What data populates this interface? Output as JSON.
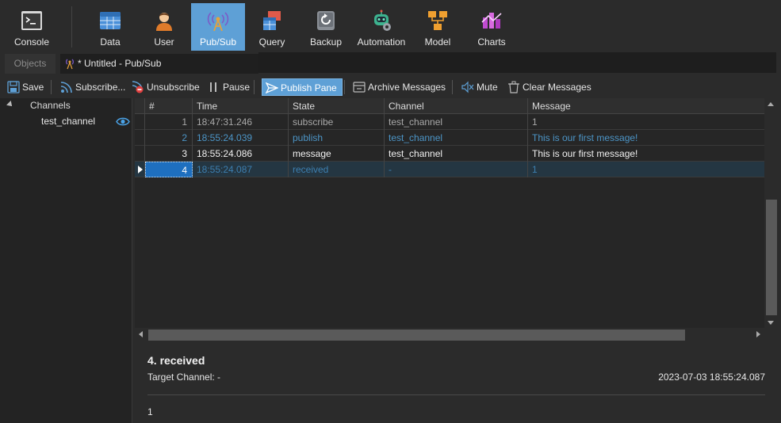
{
  "ribbon": {
    "items": [
      {
        "label": "Console",
        "icon": "console-icon"
      },
      {
        "label": "Data",
        "icon": "data-icon"
      },
      {
        "label": "User",
        "icon": "user-icon"
      },
      {
        "label": "Pub/Sub",
        "icon": "antenna-icon",
        "active": true
      },
      {
        "label": "Query",
        "icon": "query-icon"
      },
      {
        "label": "Backup",
        "icon": "backup-icon"
      },
      {
        "label": "Automation",
        "icon": "robot-icon"
      },
      {
        "label": "Model",
        "icon": "model-icon"
      },
      {
        "label": "Charts",
        "icon": "charts-icon"
      }
    ]
  },
  "tabs": {
    "objects": "Objects",
    "untitled": "* Untitled - Pub/Sub"
  },
  "toolbar": {
    "save": "Save",
    "subscribe": "Subscribe...",
    "unsubscribe": "Unsubscribe",
    "pause": "Pause",
    "publish_pane": "Publish Pane",
    "archive": "Archive Messages",
    "mute": "Mute",
    "clear": "Clear Messages"
  },
  "channels": {
    "header": "Channels",
    "items": [
      "test_channel"
    ]
  },
  "grid": {
    "columns": [
      "#",
      "Time",
      "State",
      "Channel",
      "Message"
    ],
    "rows": [
      {
        "num": "1",
        "time": "18:47:31.246",
        "state": "subscribe",
        "channel": "test_channel",
        "message": "1"
      },
      {
        "num": "2",
        "time": "18:55:24.039",
        "state": "publish",
        "channel": "test_channel",
        "message": "This is our first message!"
      },
      {
        "num": "3",
        "time": "18:55:24.086",
        "state": "message",
        "channel": "test_channel",
        "message": "This is our first message!"
      },
      {
        "num": "4",
        "time": "18:55:24.087",
        "state": "received",
        "channel": "-",
        "message": "1"
      }
    ]
  },
  "detail": {
    "title": "4.  received",
    "target_channel": "Target Channel:  -",
    "timestamp": "2023-07-03 18:55:24.087",
    "body": "1"
  },
  "colors": {
    "accent": "#5ea0d6",
    "publish_text": "#4c95c7",
    "selected_cell": "#1e6fbf"
  }
}
